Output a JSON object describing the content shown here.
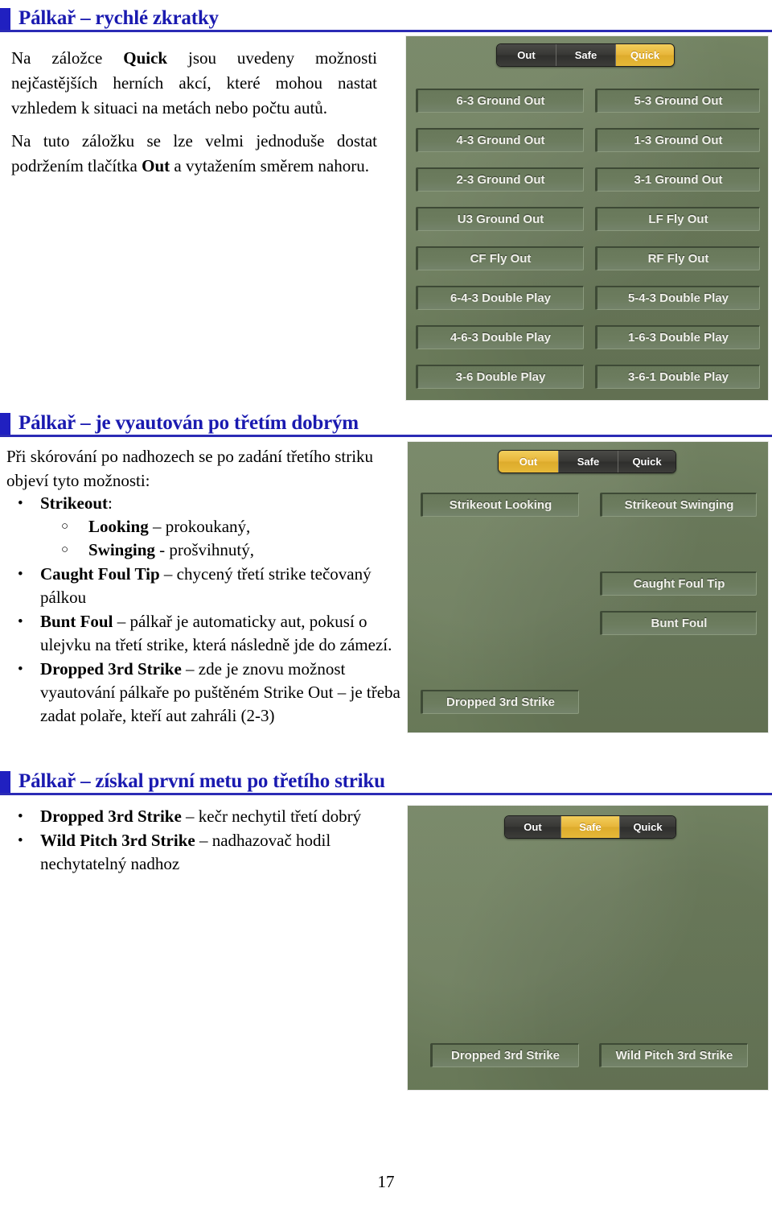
{
  "page": {
    "number": "17"
  },
  "sections": [
    {
      "heading": "Pálkař – rychlé zkratky",
      "paragraphs": [
        {
          "runs": [
            {
              "t": "Na záložce ",
              "b": false
            },
            {
              "t": "Quick",
              "b": true
            },
            {
              "t": " jsou uvedeny možnosti nejčastějších herních akcí, které mohou nastat vzhledem k situaci na metách nebo počtu autů.",
              "b": false
            }
          ]
        },
        {
          "runs": [
            {
              "t": "Na tuto záložku se lze velmi jednoduše dostat podržením tlačítka ",
              "b": false
            },
            {
              "t": "Out",
              "b": true
            },
            {
              "t": " a vytažením směrem nahoru.",
              "b": false
            }
          ]
        }
      ]
    },
    {
      "heading": "Pálkař – je vyautován po třetím dobrým",
      "intro": "Při skórování po nadhozech se po zadání třetího striku objeví tyto možnosti:",
      "bullets": [
        {
          "runs": [
            {
              "t": "Strikeout",
              "b": true
            },
            {
              "t": ":",
              "b": false
            }
          ],
          "sub": [
            {
              "runs": [
                {
                  "t": "Looking",
                  "b": true
                },
                {
                  "t": " – prokoukaný,",
                  "b": false
                }
              ]
            },
            {
              "runs": [
                {
                  "t": "Swinging",
                  "b": true
                },
                {
                  "t": " - prošvihnutý,",
                  "b": false
                }
              ]
            }
          ]
        },
        {
          "runs": [
            {
              "t": "Caught Foul Tip",
              "b": true
            },
            {
              "t": " – chycený třetí strike tečovaný pálkou",
              "b": false
            }
          ]
        },
        {
          "runs": [
            {
              "t": "Bunt Foul",
              "b": true
            },
            {
              "t": " – pálkař je automaticky aut, pokusí o ulejvku na třetí strike, která následně jde do zámezí.",
              "b": false
            }
          ]
        },
        {
          "runs": [
            {
              "t": "Dropped 3rd Strike",
              "b": true
            },
            {
              "t": " – zde je znovu možnost vyautování pálkaře po puštěném Strike Out – je třeba zadat polaře, kteří aut zahráli (2-3)",
              "b": false
            }
          ]
        }
      ]
    },
    {
      "heading": "Pálkař – získal první metu po třetího striku",
      "bullets": [
        {
          "runs": [
            {
              "t": "Dropped 3rd Strike",
              "b": true
            },
            {
              "t": " – kečr nechytil třetí dobrý",
              "b": false
            }
          ]
        },
        {
          "runs": [
            {
              "t": "Wild Pitch 3rd Strike",
              "b": true
            },
            {
              "t": " – nadhazovač hodil nechytatelný nadhoz",
              "b": false
            }
          ]
        }
      ]
    }
  ],
  "colors": {
    "heading_text": "#1a1ab0",
    "heading_marker": "#2020c0",
    "heading_rule": "#2b2bb5",
    "field_green": "#6e7f5d",
    "segment_selected": "#e8b63a",
    "segment_idle": "#383835",
    "button_label": "#f1f1ec"
  },
  "screenshots": [
    {
      "name": "quick-tab-screen",
      "segments": [
        {
          "label": "Out",
          "selected": false
        },
        {
          "label": "Safe",
          "selected": false
        },
        {
          "label": "Quick",
          "selected": true
        }
      ],
      "buttons": [
        {
          "label": "6-3 Ground Out",
          "col": "left",
          "row": 0
        },
        {
          "label": "5-3 Ground Out",
          "col": "right",
          "row": 0
        },
        {
          "label": "4-3 Ground Out",
          "col": "left",
          "row": 1
        },
        {
          "label": "1-3 Ground Out",
          "col": "right",
          "row": 1
        },
        {
          "label": "2-3 Ground Out",
          "col": "left",
          "row": 2
        },
        {
          "label": "3-1 Ground Out",
          "col": "right",
          "row": 2
        },
        {
          "label": "U3 Ground Out",
          "col": "left",
          "row": 3
        },
        {
          "label": "LF Fly Out",
          "col": "right",
          "row": 3
        },
        {
          "label": "CF Fly Out",
          "col": "left",
          "row": 4
        },
        {
          "label": "RF Fly Out",
          "col": "right",
          "row": 4
        },
        {
          "label": "6-4-3 Double Play",
          "col": "left",
          "row": 5
        },
        {
          "label": "5-4-3 Double Play",
          "col": "right",
          "row": 5
        },
        {
          "label": "4-6-3 Double Play",
          "col": "left",
          "row": 6
        },
        {
          "label": "1-6-3 Double Play",
          "col": "right",
          "row": 6
        },
        {
          "label": "3-6 Double Play",
          "col": "left",
          "row": 7
        },
        {
          "label": "3-6-1 Double Play",
          "col": "right",
          "row": 7
        }
      ]
    },
    {
      "name": "out-tab-screen",
      "segments": [
        {
          "label": "Out",
          "selected": true
        },
        {
          "label": "Safe",
          "selected": false
        },
        {
          "label": "Quick",
          "selected": false
        }
      ],
      "buttons": [
        {
          "label": "Strikeout Looking",
          "col": "left",
          "row": 0
        },
        {
          "label": "Strikeout Swinging",
          "col": "right",
          "row": 0
        },
        {
          "label": "Caught Foul Tip",
          "col": "right",
          "row": 3
        },
        {
          "label": "Bunt Foul",
          "col": "right",
          "row": 4
        },
        {
          "label": "Dropped 3rd Strike",
          "col": "left",
          "row": 8
        }
      ]
    },
    {
      "name": "safe-tab-screen",
      "segments": [
        {
          "label": "Out",
          "selected": false
        },
        {
          "label": "Safe",
          "selected": true
        },
        {
          "label": "Quick",
          "selected": false
        }
      ],
      "buttons": [
        {
          "label": "Dropped 3rd Strike",
          "col": "left",
          "row": 8
        },
        {
          "label": "Wild Pitch 3rd Strike",
          "col": "right",
          "row": 8
        }
      ]
    }
  ]
}
